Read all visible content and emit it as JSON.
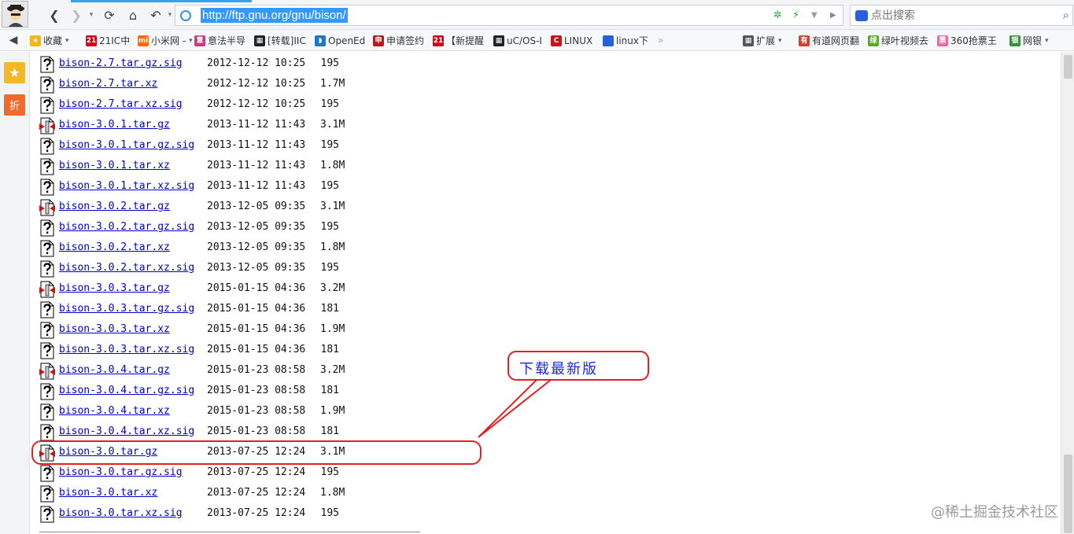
{
  "toolbar": {
    "url": "http://ftp.gnu.org/gnu/bison/",
    "search_placeholder": "点出搜索"
  },
  "bookmarks": [
    {
      "label": "收藏",
      "icon": "star-icon",
      "color": "#f3b51e",
      "glyph": "★"
    },
    {
      "label": "21IC中",
      "icon": "21ic-icon",
      "color": "#d0021b",
      "glyph": "21"
    },
    {
      "label": "小米网 -",
      "icon": "mi-icon",
      "color": "#ff6a00",
      "glyph": "mi"
    },
    {
      "label": "意法半导",
      "icon": "st-icon",
      "color": "#c93b7b",
      "glyph": "意"
    },
    {
      "label": "[转载]IIC",
      "icon": "blog-icon",
      "color": "#222222",
      "glyph": "▦"
    },
    {
      "label": "OpenEd",
      "icon": "openedv-icon",
      "color": "#1e78c8",
      "glyph": "◗"
    },
    {
      "label": "申请签约",
      "icon": "sign-icon",
      "color": "#b71c1c",
      "glyph": "申"
    },
    {
      "label": "【新提醒",
      "icon": "21ic-icon",
      "color": "#d0021b",
      "glyph": "21"
    },
    {
      "label": "uC/OS-I",
      "icon": "blog-icon",
      "color": "#222222",
      "glyph": "▦"
    },
    {
      "label": "LINUX",
      "icon": "csdn-icon",
      "color": "#c4161c",
      "glyph": "C"
    },
    {
      "label": "linux下",
      "icon": "baidu-icon",
      "color": "#2b5fd9",
      "glyph": "🐾"
    },
    {
      "label": "扩展",
      "icon": "extensions-icon",
      "color": "#555555",
      "glyph": "▦"
    },
    {
      "label": "有道网页翻",
      "icon": "youdao-icon",
      "color": "#d23f31",
      "glyph": "有"
    },
    {
      "label": "绿叶视频去",
      "icon": "greenleaf-icon",
      "color": "#5aa82a",
      "glyph": "绿"
    },
    {
      "label": "360抢票王",
      "icon": "ticket-icon",
      "color": "#e86aa0",
      "glyph": "票"
    },
    {
      "label": "网银",
      "icon": "bank-icon",
      "color": "#3a8f3a",
      "glyph": "银"
    }
  ],
  "files": [
    {
      "name": "bison-2.7.tar.gz.sig",
      "date": "2012-12-12 10:25",
      "size": "195",
      "icon": "unknown-file-icon"
    },
    {
      "name": "bison-2.7.tar.xz",
      "date": "2012-12-12 10:25",
      "size": "1.7M",
      "icon": "unknown-file-icon"
    },
    {
      "name": "bison-2.7.tar.xz.sig",
      "date": "2012-12-12 10:25",
      "size": "195",
      "icon": "unknown-file-icon"
    },
    {
      "name": "bison-3.0.1.tar.gz",
      "date": "2013-11-12 11:43",
      "size": "3.1M",
      "icon": "compressed-file-icon"
    },
    {
      "name": "bison-3.0.1.tar.gz.sig",
      "date": "2013-11-12 11:43",
      "size": "195",
      "icon": "unknown-file-icon"
    },
    {
      "name": "bison-3.0.1.tar.xz",
      "date": "2013-11-12 11:43",
      "size": "1.8M",
      "icon": "unknown-file-icon"
    },
    {
      "name": "bison-3.0.1.tar.xz.sig",
      "date": "2013-11-12 11:43",
      "size": "195",
      "icon": "unknown-file-icon"
    },
    {
      "name": "bison-3.0.2.tar.gz",
      "date": "2013-12-05 09:35",
      "size": "3.1M",
      "icon": "compressed-file-icon"
    },
    {
      "name": "bison-3.0.2.tar.gz.sig",
      "date": "2013-12-05 09:35",
      "size": "195",
      "icon": "unknown-file-icon"
    },
    {
      "name": "bison-3.0.2.tar.xz",
      "date": "2013-12-05 09:35",
      "size": "1.8M",
      "icon": "unknown-file-icon"
    },
    {
      "name": "bison-3.0.2.tar.xz.sig",
      "date": "2013-12-05 09:35",
      "size": "195",
      "icon": "unknown-file-icon"
    },
    {
      "name": "bison-3.0.3.tar.gz",
      "date": "2015-01-15 04:36",
      "size": "3.2M",
      "icon": "compressed-file-icon"
    },
    {
      "name": "bison-3.0.3.tar.gz.sig",
      "date": "2015-01-15 04:36",
      "size": "181",
      "icon": "unknown-file-icon"
    },
    {
      "name": "bison-3.0.3.tar.xz",
      "date": "2015-01-15 04:36",
      "size": "1.9M",
      "icon": "unknown-file-icon"
    },
    {
      "name": "bison-3.0.3.tar.xz.sig",
      "date": "2015-01-15 04:36",
      "size": "181",
      "icon": "unknown-file-icon"
    },
    {
      "name": "bison-3.0.4.tar.gz",
      "date": "2015-01-23 08:58",
      "size": "3.2M",
      "icon": "compressed-file-icon"
    },
    {
      "name": "bison-3.0.4.tar.gz.sig",
      "date": "2015-01-23 08:58",
      "size": "181",
      "icon": "unknown-file-icon"
    },
    {
      "name": "bison-3.0.4.tar.xz",
      "date": "2015-01-23 08:58",
      "size": "1.9M",
      "icon": "unknown-file-icon"
    },
    {
      "name": "bison-3.0.4.tar.xz.sig",
      "date": "2015-01-23 08:58",
      "size": "181",
      "icon": "unknown-file-icon"
    },
    {
      "name": "bison-3.0.tar.gz",
      "date": "2013-07-25 12:24",
      "size": "3.1M",
      "icon": "compressed-file-icon"
    },
    {
      "name": "bison-3.0.tar.gz.sig",
      "date": "2013-07-25 12:24",
      "size": "195",
      "icon": "unknown-file-icon"
    },
    {
      "name": "bison-3.0.tar.xz",
      "date": "2013-07-25 12:24",
      "size": "1.8M",
      "icon": "unknown-file-icon"
    },
    {
      "name": "bison-3.0.tar.xz.sig",
      "date": "2013-07-25 12:24",
      "size": "195",
      "icon": "unknown-file-icon"
    }
  ],
  "annotation": {
    "callout_text": "下载最新版",
    "color": "#e02020",
    "text_color": "#1a2ad6"
  },
  "watermark": "@稀土掘金技术社区"
}
